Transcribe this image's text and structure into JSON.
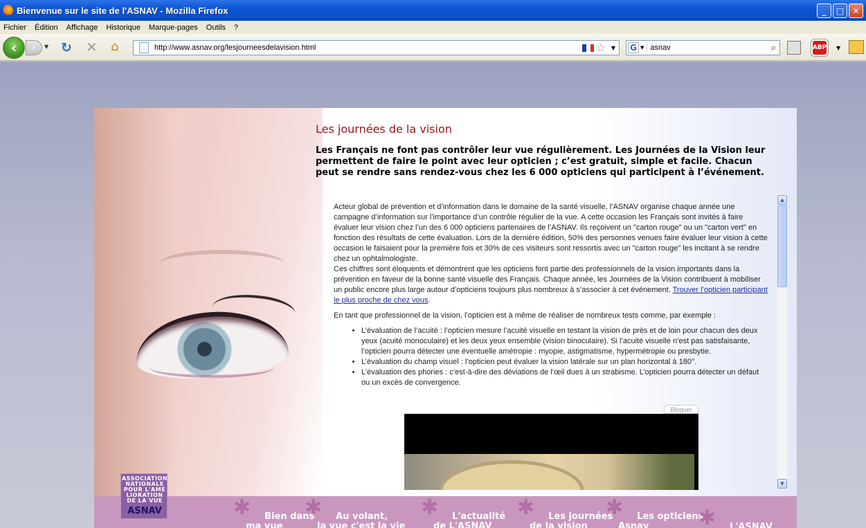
{
  "window": {
    "title": "Bienvenue sur le site de l'ASNAV - Mozilla Firefox",
    "minimize": "_",
    "maximize": "□",
    "close": "✕"
  },
  "menu": [
    "Fichier",
    "Édition",
    "Affichage",
    "Historique",
    "Marque-pages",
    "Outils",
    "?"
  ],
  "toolbar": {
    "url": "http://www.asnav.org/lesjourneesdelavision.html",
    "search_value": "asnav",
    "search_engine_letter": "G",
    "abp_label": "ABP"
  },
  "page": {
    "title": "Les journées de la vision",
    "intro": "Les Français ne font pas contrôler leur vue régulièrement. Les Journées de la Vision leur permettent de faire le point avec leur opticien ; c’est gratuit, simple et facile. Chacun peut se rendre sans rendez-vous chez les 6 000 opticiens qui participent à l’événement.",
    "para1": "Acteur global de prévention et d’information dans le domaine de la santé visuelle, l’ASNAV organise chaque année une campagne d’information sur l’importance d’un contrôle régulier de la vue. A cette occasion les Français sont invités à faire évaluer leur vision chez l’un des 6 000 opticiens partenaires de l’ASNAV. Ils reçoivent un \"carton rouge\" ou un \"carton vert\" en fonction des résultats de cette évaluation. Lors de la dernière édition, 50% des personnes venues faire évaluer leur vision à cette occasion le faisaient pour la première fois et 30% de ces visiteurs sont ressortis avec un \"carton rouge\" les incitant à se rendre chez un ophtalmologiste.",
    "para2": "Ces chiffres sont éloquents et démontrent que les opticiens font partie des professionnels de la vision importants dans la prévention en faveur de la bonne santé visuelle des Français. Chaque année, les Journées de la Vision contribuent à mobiliser un public encore plus large autour d’opticiens toujours plus nombreux à s’associer à cet événement.",
    "link": "Trouver l’opticien participant le plus proche de chez vous",
    "link_suffix": ".",
    "para3": "En tant que professionnel de la vision, l’opticien est à même de réaliser de nombreux tests comme, par exemple :",
    "bullets": [
      "L’évaluation de l’acuité : l’opticien mesure l’acuité visuelle en testant la vision de près et de loin pour chacun des deux yeux (acuité monoculaire) et les deux yeux ensemble (vision binoculaire). Si l’acuité visuelle n’est pas satisfaisante, l’opticien pourra détecter une éventuelle amétropie : myopie, astigmatisme, hypermétropie ou presbytie.",
      "L’évaluation du champ visuel : l’opticien peut évaluer la vision latérale sur un plan horizontal à 180°.",
      "L’évaluation des phories : c’est-à-dire des déviations de l’œil dues à un strabisme. L’opticien pourra détecter un défaut ou un excès de convergence."
    ],
    "bloquer": "Bloquer"
  },
  "logo": {
    "line1": "ASSOCIATION",
    "line2": "NATIONALE",
    "line3": "POUR L'AME",
    "line4": "LIORATION",
    "line5": "DE LA VUE",
    "name": "ASNAV"
  },
  "nav": [
    "Bien dans\nma vue",
    "Au volant,\nla vue c'est la vie",
    "L'actualité\nde L'ASNAV",
    "Les journées\nde la vision",
    "Les opticiens\nAsnav",
    "L'ASNAV"
  ],
  "colors": {
    "accent_title": "#99131b",
    "nav_bg": "#c997be",
    "link": "#1b2aa0"
  }
}
